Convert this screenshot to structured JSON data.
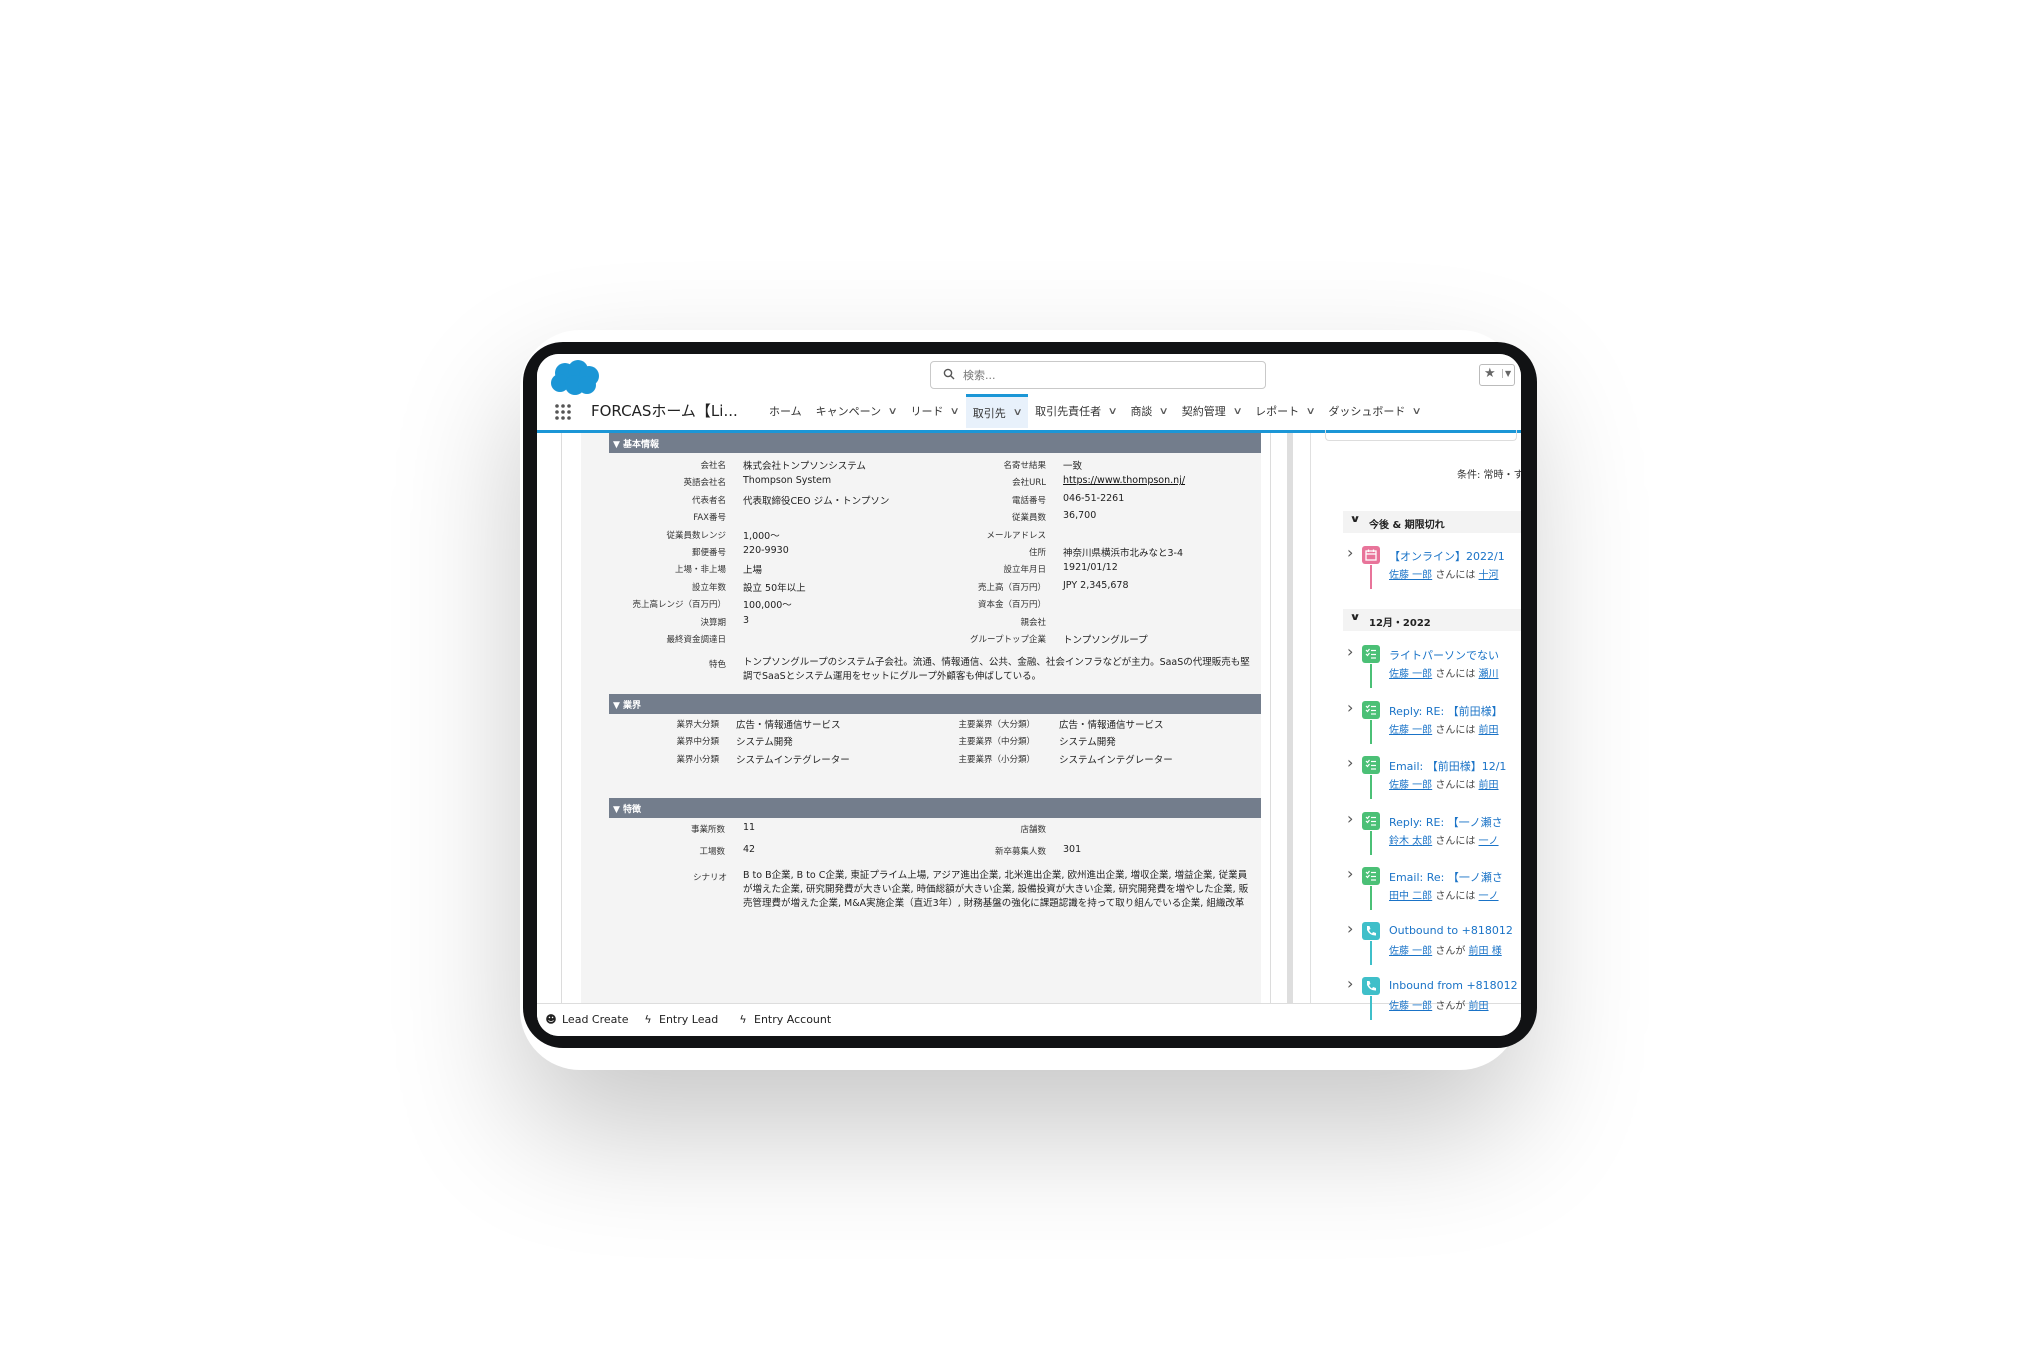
{
  "header": {
    "search_placeholder": "検索...",
    "app_name": "FORCASホーム【Li...",
    "nav": [
      {
        "label": "ホーム",
        "dropdown": false
      },
      {
        "label": "キャンペーン",
        "dropdown": true
      },
      {
        "label": "リード",
        "dropdown": true
      },
      {
        "label": "取引先",
        "dropdown": true,
        "active": true
      },
      {
        "label": "取引先責任者",
        "dropdown": true
      },
      {
        "label": "商談",
        "dropdown": true
      },
      {
        "label": "契約管理",
        "dropdown": true
      },
      {
        "label": "レポート",
        "dropdown": true
      },
      {
        "label": "ダッシュボード",
        "dropdown": true
      }
    ]
  },
  "sections": {
    "basic": "▼ 基本情報",
    "industry": "▼ 業界",
    "features": "▼ 特徴"
  },
  "basic_left": [
    {
      "label": "会社名",
      "value": "株式会社トンプソンシステム"
    },
    {
      "label": "英語会社名",
      "value": "Thompson System"
    },
    {
      "label": "代表者名",
      "value": "代表取締役CEO ジム・トンプソン"
    },
    {
      "label": "FAX番号",
      "value": ""
    },
    {
      "label": "従業員数レンジ",
      "value": "1,000〜"
    },
    {
      "label": "郵便番号",
      "value": "220-9930"
    },
    {
      "label": "上場・非上場",
      "value": "上場"
    },
    {
      "label": "設立年数",
      "value": "設立 50年以上"
    },
    {
      "label": "売上高レンジ（百万円）",
      "value": "100,000〜"
    },
    {
      "label": "決算期",
      "value": "3"
    },
    {
      "label": "最終資金調達日",
      "value": ""
    }
  ],
  "basic_right": [
    {
      "label": "名寄せ結果",
      "value": "一致"
    },
    {
      "label": "会社URL",
      "value": "https://www.thompson.nj/"
    },
    {
      "label": "電話番号",
      "value": "046-51-2261"
    },
    {
      "label": "従業員数",
      "value": "36,700"
    },
    {
      "label": "メールアドレス",
      "value": ""
    },
    {
      "label": "住所",
      "value": "神奈川県横浜市北みなと3-4"
    },
    {
      "label": "設立年月日",
      "value": "1921/01/12"
    },
    {
      "label": "売上高（百万円）",
      "value": "JPY 2,345,678"
    },
    {
      "label": "資本金（百万円）",
      "value": ""
    },
    {
      "label": "親会社",
      "value": ""
    },
    {
      "label": "グループトップ企業",
      "value": "トンプソングループ"
    }
  ],
  "feature_text": {
    "label": "特色",
    "value": "トンプソングループのシステム子会社。流通、情報通信、公共、金融、社会インフラなどが主力。SaaSの代理販売も堅調でSaaSとシステム運用をセットにグループ外顧客も伸ばしている。"
  },
  "industry_left": [
    {
      "label": "業界大分類",
      "value": "広告・情報通信サービス"
    },
    {
      "label": "業界中分類",
      "value": "システム開発"
    },
    {
      "label": "業界小分類",
      "value": "システムインテグレーター"
    }
  ],
  "industry_right": [
    {
      "label": "主要業界（大分類）",
      "value": "広告・情報通信サービス"
    },
    {
      "label": "主要業界（中分類）",
      "value": "システム開発"
    },
    {
      "label": "主要業界（小分類）",
      "value": "システムインテグレーター"
    }
  ],
  "features_left": [
    {
      "label": "事業所数",
      "value": "11"
    },
    {
      "label": "工場数",
      "value": "42"
    }
  ],
  "features_right": [
    {
      "label": "店舗数",
      "value": ""
    },
    {
      "label": "新卒募集人数",
      "value": "301"
    }
  ],
  "scenario": {
    "label": "シナリオ",
    "value": "B to B企業, B to C企業, 東証プライム上場, アジア進出企業, 北米進出企業, 欧州進出企業, 増収企業, 増益企業, 従業員が増えた企業, 研究開発費が大きい企業, 時価総額が大きい企業, 設備投資が大きい企業, 研究開発費を増やした企業, 販売管理費が増えた企業, M&A実施企業（直近3年）, 財務基盤の強化に課題認識を持って取り組んでいる企業, 組織改革"
  },
  "activity": {
    "condition": "条件: 常時・す",
    "groups": [
      {
        "label": "今後 & 期限切れ"
      },
      {
        "label": "12月・2022"
      }
    ],
    "items": [
      {
        "title": "【オンライン】2022/1",
        "sub_prefix": "佐藤 一郎",
        "sub_mid": " さんには ",
        "sub_link": "十河",
        "color": "#e8749a",
        "icon": "calendar-icon"
      },
      {
        "title": "ライトパーソンでない",
        "sub_prefix": "佐藤 一郎",
        "sub_mid": " さんには ",
        "sub_link": "瀬川",
        "color": "#4bc076",
        "icon": "task-icon"
      },
      {
        "title": "Reply: RE: 【前田様】",
        "sub_prefix": "佐藤 一郎",
        "sub_mid": " さんには ",
        "sub_link": "前田",
        "color": "#4bc076",
        "icon": "task-icon"
      },
      {
        "title": "Email: 【前田様】12/1",
        "sub_prefix": "佐藤 一郎",
        "sub_mid": " さんには ",
        "sub_link": "前田",
        "color": "#4bc076",
        "icon": "task-icon"
      },
      {
        "title": "Reply: RE: 【一ノ瀬さ",
        "sub_prefix": "鈴木 太郎",
        "sub_mid": " さんには ",
        "sub_link": "一ノ",
        "color": "#4bc076",
        "icon": "task-icon"
      },
      {
        "title": "Email: Re: 【一ノ瀬さ",
        "sub_prefix": "田中 二郎",
        "sub_mid": " さんには ",
        "sub_link": "一ノ",
        "color": "#4bc076",
        "icon": "task-icon"
      },
      {
        "title": "Outbound to +818012",
        "sub_prefix": "佐藤 一郎",
        "sub_mid": " さんが ",
        "sub_link": "前田 様",
        "color": "#3fbfc9",
        "icon": "phone-icon"
      },
      {
        "title": "Inbound from +818012",
        "sub_prefix": "佐藤 一郎",
        "sub_mid": " さんが ",
        "sub_link": "前田",
        "color": "#3fbfc9",
        "icon": "phone-icon"
      }
    ]
  },
  "footer": [
    {
      "label": "Lead Create",
      "icon": "smiley-icon"
    },
    {
      "label": "Entry Lead",
      "icon": "lightning-icon"
    },
    {
      "label": "Entry Account",
      "icon": "lightning-icon"
    }
  ],
  "colors": {
    "brand": "#1b96d6",
    "section_bar": "#737d8c",
    "link": "#1a73c7"
  }
}
